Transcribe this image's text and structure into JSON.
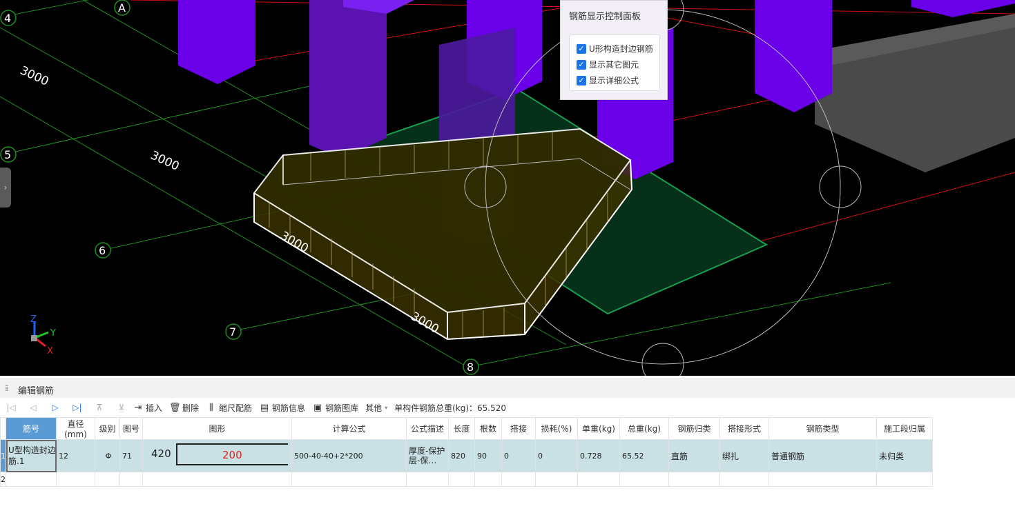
{
  "viewport": {
    "grid_labels": {
      "axis_a": "A",
      "axis_4": "4",
      "axis_5": "5",
      "axis_6": "6",
      "axis_7": "7",
      "axis_8": "8"
    },
    "dimension_labels": [
      "3000",
      "3000",
      "3000",
      "3000"
    ],
    "axes_triad": {
      "z": "Z",
      "y": "Y",
      "x": "X"
    },
    "colors": {
      "column": "#6a00e8",
      "slab": "#0a2a14",
      "grid_line": "#1f8f1f",
      "red_line": "#d01010",
      "footing_edge": "#ffffff"
    }
  },
  "control_panel": {
    "title": "钢筋显示控制面板",
    "options": [
      {
        "label": "U形构造封边钢筋",
        "checked": true
      },
      {
        "label": "显示其它图元",
        "checked": true
      },
      {
        "label": "显示详细公式",
        "checked": true
      }
    ]
  },
  "panel": {
    "title": "编辑钢筋"
  },
  "toolbar": {
    "insert": "插入",
    "delete": "删除",
    "scale_rebar": "缩尺配筋",
    "rebar_info": "钢筋信息",
    "rebar_library": "钢筋图库",
    "other": "其他",
    "total_weight": "单构件钢筋总重(kg)：65.520"
  },
  "table": {
    "headers": [
      "筋号",
      "直径(mm)",
      "级别",
      "图号",
      "图形",
      "计算公式",
      "公式描述",
      "长度",
      "根数",
      "搭接",
      "损耗(%)",
      "单重(kg)",
      "总重(kg)",
      "钢筋归类",
      "搭接形式",
      "钢筋类型",
      "施工段归属"
    ],
    "row_numbers": [
      "1",
      "2"
    ],
    "rows": [
      {
        "bar_no": "U型构造封边筋.1",
        "diameter": "12",
        "grade": "Φ",
        "shape_no": "71",
        "shape_left": "420",
        "shape_mid": "200",
        "formula": "500-40-40+2*200",
        "formula_desc": "厚度-保护层-保…",
        "length": "820",
        "count": "90",
        "lap": "0",
        "loss": "0",
        "unit_weight": "0.728",
        "total_weight": "65.52",
        "category": "直筋",
        "lap_type": "绑扎",
        "rebar_type": "普通钢筋",
        "segment": "未归类"
      }
    ]
  }
}
